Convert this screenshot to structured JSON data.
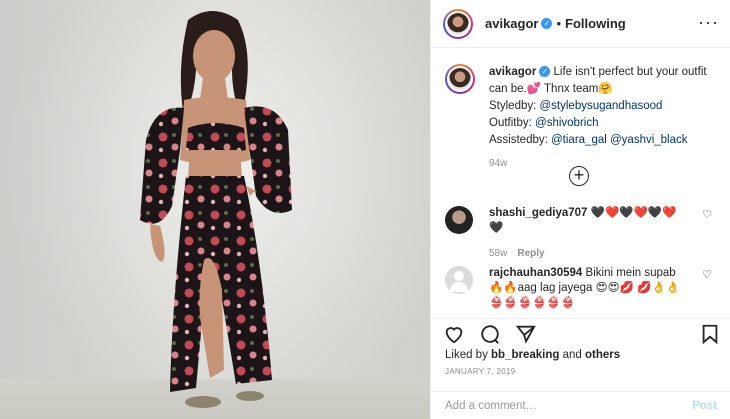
{
  "post": {
    "username": "avikagor",
    "follow_status": "Following",
    "more_icon": "more-options-icon"
  },
  "caption": {
    "username": "avikagor",
    "text_line1": "Life isn't perfect but your outfit can be.💕 Thnx team🤗",
    "styled_label": "Styledby: ",
    "styled_handle": "@stylebysugandhasood",
    "outfit_label": "Outfitby: ",
    "outfit_handle": "@shivobrich",
    "assisted_label": "Assistedby: ",
    "assisted_handle1": "@tiara_gal",
    "assisted_handle2": "@yashvi_black",
    "age": "94w"
  },
  "load_more": "+",
  "comments": [
    {
      "username": "shashi_gediya707",
      "text": "🖤❤️🖤❤️🖤❤️ 🖤",
      "age": "58w",
      "reply": "Reply"
    },
    {
      "username": "rajchauhan30594",
      "text": "Bikini mein supab 🔥🔥aag lag jayega 😍😍💋 💋👌👌👙👙👙👙👙👙"
    }
  ],
  "likes": {
    "prefix": "Liked by ",
    "user": "bb_breaking",
    "mid": " and ",
    "others": "others"
  },
  "date": "JANUARY 7, 2019",
  "add_comment": {
    "placeholder": "Add a comment…",
    "post_label": "Post"
  },
  "colors": {
    "link": "#003569",
    "verified": "#3897f0",
    "post_disabled": "#b2dffc"
  }
}
